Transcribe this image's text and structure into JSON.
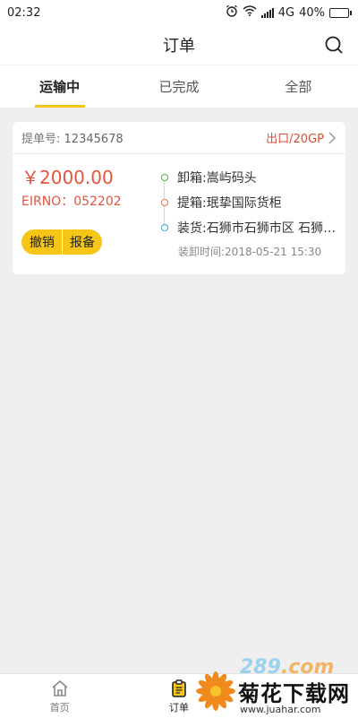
{
  "status_bar": {
    "time": "02:32",
    "network": "4G",
    "battery": "40%",
    "battery_level": 0.4
  },
  "header": {
    "title": "订单",
    "search_icon": "search-icon"
  },
  "tabs": [
    {
      "label": "运输中",
      "active": true
    },
    {
      "label": "已完成",
      "active": false
    },
    {
      "label": "全部",
      "active": false
    }
  ],
  "order": {
    "bill_no_label": "提单号:",
    "bill_no": "12345678",
    "container_type": "出口/20GP",
    "price": "￥2000.00",
    "eirno": "EIRNO：052202",
    "stops": [
      {
        "text": "卸箱:嵩屿码头",
        "color": "#5aa84a"
      },
      {
        "text": "提箱:珉挚国际货柜",
        "color": "#e0734f"
      },
      {
        "text": "装货:石狮市石狮市区 石狮市石狮市区",
        "color": "#2fb0c9"
      }
    ],
    "load_time": "装卸时间:2018-05-21 15:30",
    "buttons": {
      "cancel": "撤销",
      "report": "报备"
    }
  },
  "bottom_nav": [
    {
      "label": "首页",
      "icon": "home-icon",
      "active": false
    },
    {
      "label": "订单",
      "icon": "clipboard-icon",
      "active": true
    }
  ],
  "watermark": {
    "brand": "289",
    "dot": ".com",
    "title": "菊花下载网",
    "url": "www.juahar.com"
  },
  "colors": {
    "accent": "#f5c518",
    "price": "#e1553f"
  }
}
